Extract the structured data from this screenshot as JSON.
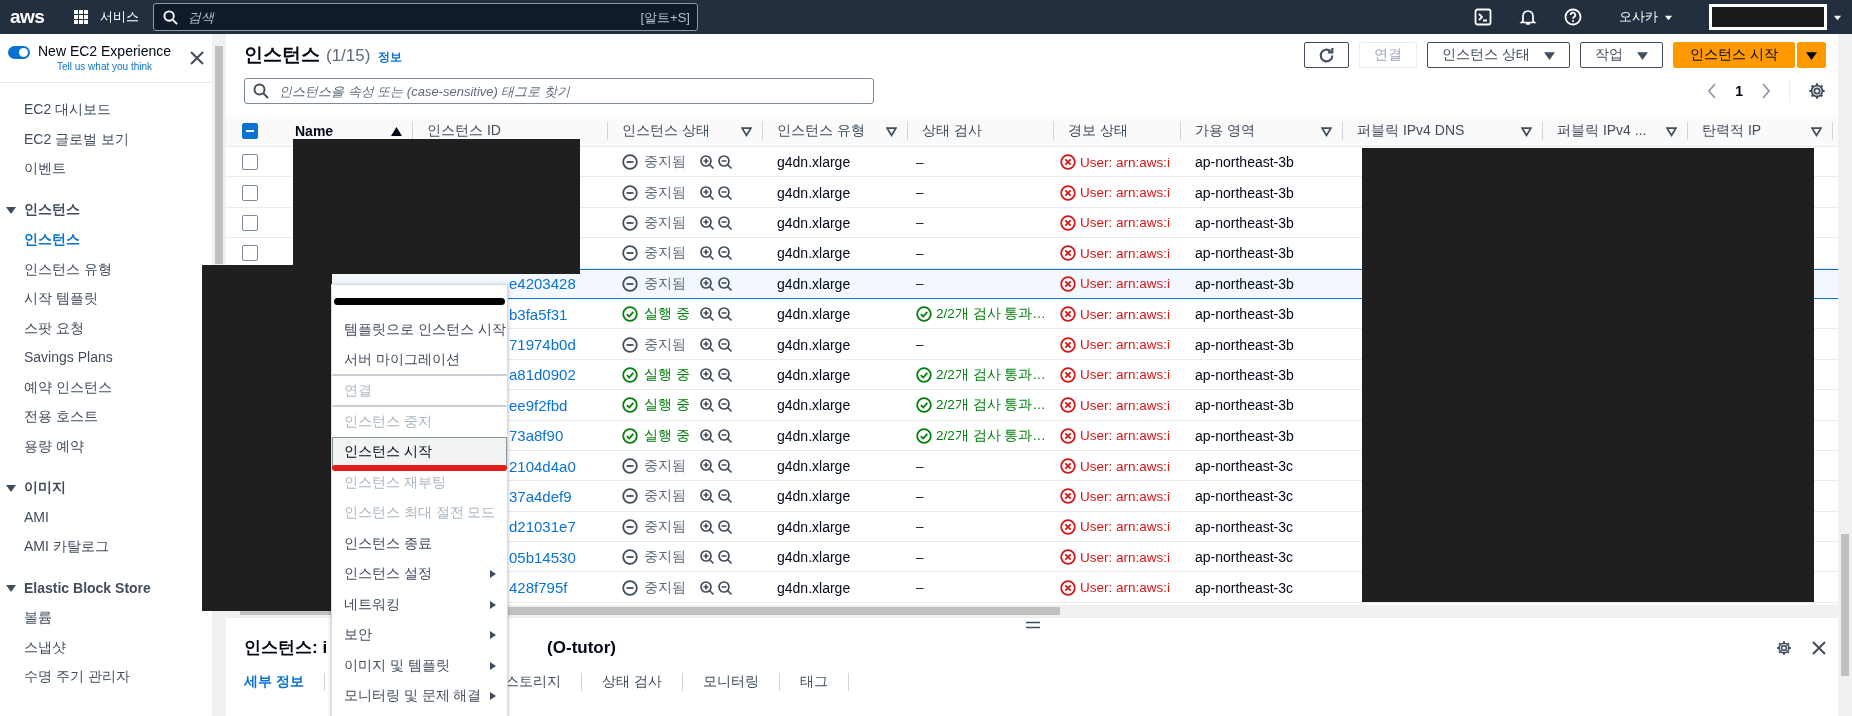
{
  "top_bar": {
    "logo": "aws",
    "services": "서비스",
    "search": {
      "placeholder": "검색",
      "shortcut": "[알트+S]"
    },
    "region": "오사카"
  },
  "sidebar": {
    "experience": {
      "title": "New EC2 Experience",
      "link": "Tell us what you think",
      "on": true
    },
    "top_items": [
      {
        "label": "EC2 대시보드",
        "selected": false
      },
      {
        "label": "EC2 글로벌 보기",
        "selected": false
      },
      {
        "label": "이벤트",
        "selected": false
      }
    ],
    "sections": [
      {
        "label": "인스턴스",
        "expanded": true,
        "items": [
          {
            "label": "인스턴스",
            "selected": true
          },
          {
            "label": "인스턴스 유형",
            "selected": false
          },
          {
            "label": "시작 템플릿",
            "selected": false
          },
          {
            "label": "스팟 요청",
            "selected": false
          },
          {
            "label": "Savings Plans",
            "selected": false
          },
          {
            "label": "예약 인스턴스",
            "selected": false
          },
          {
            "label": "전용 호스트",
            "selected": false
          },
          {
            "label": "용량 예약",
            "selected": false
          }
        ]
      },
      {
        "label": "이미지",
        "expanded": true,
        "items": [
          {
            "label": "AMI",
            "selected": false
          },
          {
            "label": "AMI 카탈로그",
            "selected": false
          }
        ]
      },
      {
        "label": "Elastic Block Store",
        "expanded": true,
        "items": [
          {
            "label": "볼륨",
            "selected": false
          },
          {
            "label": "스냅샷",
            "selected": false
          },
          {
            "label": "수명 주기 관리자",
            "selected": false
          }
        ]
      }
    ]
  },
  "page": {
    "title": "인스턴스",
    "count": "(1/15)",
    "info": "정보",
    "search_placeholder": "인스턴스을 속성 또는 (case-sensitive) 태그로 찾기",
    "page_number": "1"
  },
  "actions": [
    {
      "kind": "refresh"
    },
    {
      "kind": "button",
      "label": "연결",
      "disabled": true
    },
    {
      "kind": "dropdown",
      "label": "인스턴스 상태",
      "disabled": false
    },
    {
      "kind": "dropdown",
      "label": "작업",
      "disabled": false
    },
    {
      "kind": "primary-split",
      "label": "인스턴스 시작"
    }
  ],
  "table": {
    "header_indeterminate": true,
    "columns": [
      {
        "label": "Name",
        "sort_ascending": true
      },
      {
        "label": "인스턴스 ID"
      },
      {
        "label": "인스턴스 상태",
        "filter": true
      },
      {
        "label": "인스턴스 유형",
        "filter": true
      },
      {
        "label": "상태 검사"
      },
      {
        "label": "경보 상태"
      },
      {
        "label": "가용 영역",
        "filter": true
      },
      {
        "label": "퍼블릭 IPv4 DNS",
        "filter": true
      },
      {
        "label": "퍼블릭 IPv4 ...",
        "filter": true
      },
      {
        "label": "탄력적 IP",
        "filter": true
      }
    ],
    "rows": [
      {
        "checked": false,
        "selected": false,
        "state": {
          "kind": "stopped",
          "label": "중지됨"
        },
        "type": "g4dn.xlarge",
        "check": {
          "kind": "none",
          "label": "–"
        },
        "alarm": "User: arn:aws:i",
        "zone": "ap-northeast-3b"
      },
      {
        "checked": false,
        "selected": false,
        "state": {
          "kind": "stopped",
          "label": "중지됨"
        },
        "type": "g4dn.xlarge",
        "check": {
          "kind": "none",
          "label": "–"
        },
        "alarm": "User: arn:aws:i",
        "zone": "ap-northeast-3b"
      },
      {
        "checked": false,
        "selected": false,
        "state": {
          "kind": "stopped",
          "label": "중지됨"
        },
        "type": "g4dn.xlarge",
        "check": {
          "kind": "none",
          "label": "–"
        },
        "alarm": "User: arn:aws:i",
        "zone": "ap-northeast-3b"
      },
      {
        "checked": false,
        "selected": false,
        "state": {
          "kind": "stopped",
          "label": "중지됨"
        },
        "type": "g4dn.xlarge",
        "check": {
          "kind": "none",
          "label": "–"
        },
        "alarm": "User: arn:aws:i",
        "zone": "ap-northeast-3b"
      },
      {
        "selected": true,
        "instance_id": "e4203428",
        "state": {
          "kind": "stopped",
          "label": "중지됨"
        },
        "type": "g4dn.xlarge",
        "check": {
          "kind": "none",
          "label": "–"
        },
        "alarm": "User: arn:aws:i",
        "zone": "ap-northeast-3b"
      },
      {
        "selected": false,
        "instance_id": "b3fa5f31",
        "state": {
          "kind": "running",
          "label": "실행 중"
        },
        "type": "g4dn.xlarge",
        "check": {
          "kind": "passed",
          "label": "2/2개 검사 통과…"
        },
        "alarm": "User: arn:aws:i",
        "zone": "ap-northeast-3b"
      },
      {
        "selected": false,
        "instance_id": "71974b0d",
        "state": {
          "kind": "stopped",
          "label": "중지됨"
        },
        "type": "g4dn.xlarge",
        "check": {
          "kind": "none",
          "label": "–"
        },
        "alarm": "User: arn:aws:i",
        "zone": "ap-northeast-3b"
      },
      {
        "selected": false,
        "instance_id": "a81d0902",
        "state": {
          "kind": "running",
          "label": "실행 중"
        },
        "type": "g4dn.xlarge",
        "check": {
          "kind": "passed",
          "label": "2/2개 검사 통과…"
        },
        "alarm": "User: arn:aws:i",
        "zone": "ap-northeast-3b"
      },
      {
        "selected": false,
        "instance_id": "ee9f2fbd",
        "state": {
          "kind": "running",
          "label": "실행 중"
        },
        "type": "g4dn.xlarge",
        "check": {
          "kind": "passed",
          "label": "2/2개 검사 통과…"
        },
        "alarm": "User: arn:aws:i",
        "zone": "ap-northeast-3b"
      },
      {
        "selected": false,
        "instance_id": "73a8f90",
        "state": {
          "kind": "running",
          "label": "실행 중"
        },
        "type": "g4dn.xlarge",
        "check": {
          "kind": "passed",
          "label": "2/2개 검사 통과…"
        },
        "alarm": "User: arn:aws:i",
        "zone": "ap-northeast-3b"
      },
      {
        "selected": false,
        "instance_id": "2104d4a0",
        "state": {
          "kind": "stopped",
          "label": "중지됨"
        },
        "type": "g4dn.xlarge",
        "check": {
          "kind": "none",
          "label": "–"
        },
        "alarm": "User: arn:aws:i",
        "zone": "ap-northeast-3c"
      },
      {
        "selected": false,
        "instance_id": "37a4def9",
        "state": {
          "kind": "stopped",
          "label": "중지됨"
        },
        "type": "g4dn.xlarge",
        "check": {
          "kind": "none",
          "label": "–"
        },
        "alarm": "User: arn:aws:i",
        "zone": "ap-northeast-3c"
      },
      {
        "selected": false,
        "instance_id": "d21031e7",
        "state": {
          "kind": "stopped",
          "label": "중지됨"
        },
        "type": "g4dn.xlarge",
        "check": {
          "kind": "none",
          "label": "–"
        },
        "alarm": "User: arn:aws:i",
        "zone": "ap-northeast-3c"
      },
      {
        "selected": false,
        "instance_id": "05b14530",
        "state": {
          "kind": "stopped",
          "label": "중지됨"
        },
        "type": "g4dn.xlarge",
        "check": {
          "kind": "none",
          "label": "–"
        },
        "alarm": "User: arn:aws:i",
        "zone": "ap-northeast-3c"
      },
      {
        "selected": false,
        "instance_id": "428f795f",
        "state": {
          "kind": "stopped",
          "label": "중지됨"
        },
        "type": "g4dn.xlarge",
        "check": {
          "kind": "none",
          "label": "–"
        },
        "alarm": "User: arn:aws:i",
        "zone": "ap-northeast-3c"
      }
    ]
  },
  "context_menu": {
    "items": [
      {
        "kind": "redacted"
      },
      {
        "kind": "action",
        "label": "템플릿으로 인스턴스 시작",
        "disabled": false,
        "highlighted": false,
        "annotated": false,
        "divider_after": false
      },
      {
        "kind": "action",
        "label": "서버 마이그레이션",
        "disabled": false,
        "highlighted": false,
        "annotated": false,
        "divider_after": true
      },
      {
        "kind": "action",
        "label": "연결",
        "disabled": true,
        "highlighted": false,
        "annotated": false,
        "divider_after": true
      },
      {
        "kind": "action",
        "label": "인스턴스 중지",
        "disabled": true,
        "highlighted": false,
        "annotated": false,
        "divider_after": false
      },
      {
        "kind": "action",
        "label": "인스턴스 시작",
        "disabled": false,
        "highlighted": true,
        "annotated": true,
        "divider_after": false
      },
      {
        "kind": "action",
        "label": "인스턴스 재부팅",
        "disabled": true,
        "highlighted": false,
        "annotated": false,
        "divider_after": false
      },
      {
        "kind": "action",
        "label": "인스턴스 최대 절전 모드",
        "disabled": true,
        "highlighted": false,
        "annotated": false,
        "divider_after": false
      },
      {
        "kind": "action",
        "label": "인스턴스 종료",
        "disabled": false,
        "highlighted": false,
        "annotated": false,
        "divider_after": false
      },
      {
        "kind": "submenu",
        "label": "인스턴스 설정",
        "disabled": false,
        "highlighted": false,
        "annotated": false,
        "divider_after": false
      },
      {
        "kind": "submenu",
        "label": "네트워킹",
        "disabled": false,
        "highlighted": false,
        "annotated": false,
        "divider_after": false
      },
      {
        "kind": "submenu",
        "label": "보안",
        "disabled": false,
        "highlighted": false,
        "annotated": false,
        "divider_after": false
      },
      {
        "kind": "submenu",
        "label": "이미지 및 템플릿",
        "disabled": false,
        "highlighted": false,
        "annotated": false,
        "divider_after": false
      },
      {
        "kind": "submenu",
        "label": "모니터링 및 문제 해결",
        "disabled": false,
        "highlighted": false,
        "annotated": false,
        "divider_after": false
      }
    ]
  },
  "details_panel": {
    "title_start": "인스턴스: i",
    "title_end": "(O-tutor)",
    "tabs": [
      {
        "label": "세부 정보",
        "selected": true
      },
      {
        "label": "스토리지",
        "selected": false
      },
      {
        "label": "상태 검사",
        "selected": false
      },
      {
        "label": "모니터링",
        "selected": false
      },
      {
        "label": "태그",
        "selected": false
      }
    ]
  }
}
